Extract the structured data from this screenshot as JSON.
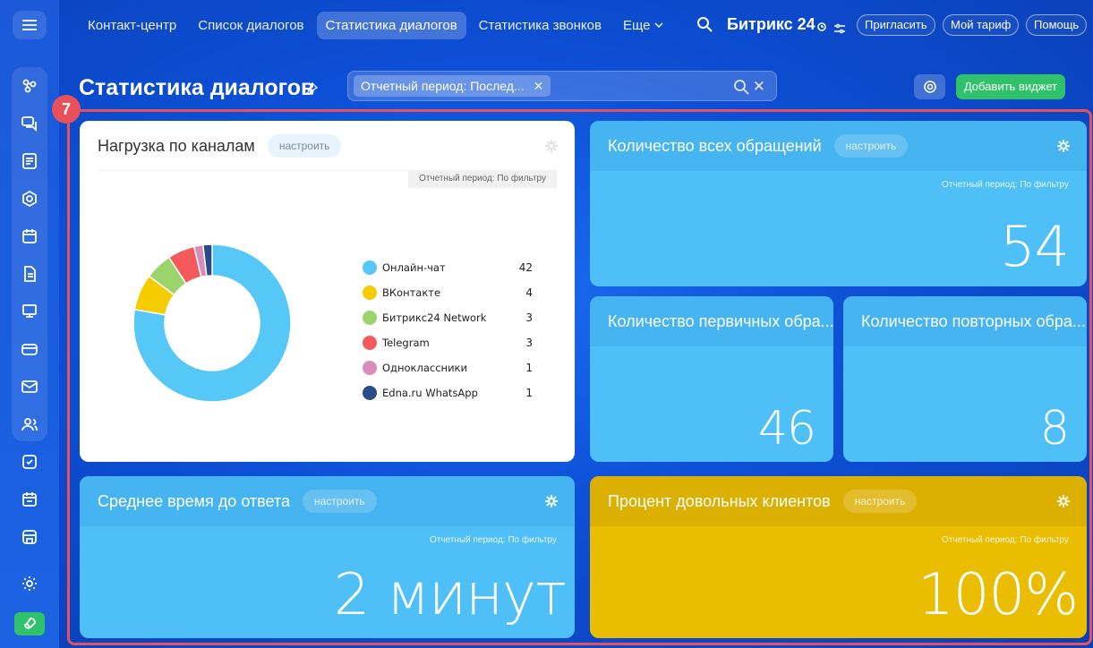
{
  "nav": {
    "items": [
      "Контакт-центр",
      "Список диалогов",
      "Статистика диалогов",
      "Статистика звонков"
    ],
    "more_label": "Еще"
  },
  "brand": {
    "name": "Битрикс 24"
  },
  "header_buttons": {
    "invite": "Пригласить",
    "tariff": "Мой тариф",
    "help": "Помощь"
  },
  "page": {
    "title": "Статистика диалогов"
  },
  "filter": {
    "chip": "Отчетный период: Послед..."
  },
  "actions": {
    "add_widget": "Добавить виджет"
  },
  "highlight": {
    "number": "7"
  },
  "widgets": {
    "channels": {
      "title": "Нагрузка по каналам",
      "configure": "настроить",
      "period": "Отчетный период: По фильтру",
      "items": [
        {
          "name": "Онлайн-чат",
          "count": 42,
          "color": "#55c8f8"
        },
        {
          "name": "ВКонтакте",
          "count": 4,
          "color": "#f5cc00"
        },
        {
          "name": "Битрикс24 Network",
          "count": 3,
          "color": "#9bd46a"
        },
        {
          "name": "Telegram",
          "count": 3,
          "color": "#f45a5c"
        },
        {
          "name": "Одноклассники",
          "count": 1,
          "color": "#d98dbb"
        },
        {
          "name": "Edna.ru WhatsApp",
          "count": 1,
          "color": "#2b4a8a"
        }
      ]
    },
    "all_requests": {
      "title": "Количество всех обращений",
      "configure": "настроить",
      "period": "Отчетный период: По фильтру",
      "value": "54"
    },
    "first_requests": {
      "title": "Количество первичных обра...",
      "value": "46"
    },
    "repeat_requests": {
      "title": "Количество повторных обра...",
      "value": "8"
    },
    "response_time": {
      "title": "Среднее время до ответа",
      "configure": "настроить",
      "period": "Отчетный период: По фильтру",
      "value": "2 минут"
    },
    "satisfaction": {
      "title": "Процент довольных клиентов",
      "configure": "настроить",
      "period": "Отчетный период: По фильтру",
      "value": "100%"
    }
  },
  "colors": {
    "accent_green": "#2fc26b",
    "highlight_red": "#e8505b",
    "widget_blue": "#4fc0f7",
    "widget_yellow": "#ebbd00"
  },
  "icons": {
    "sidebar": [
      "menu-icon",
      "flow-icon",
      "chat-icon",
      "feed-icon",
      "shield-icon",
      "calendar-icon",
      "document-icon",
      "presentation-icon",
      "card-icon",
      "mail-icon",
      "contacts-icon",
      "task-check-icon",
      "schedule-icon",
      "store-icon",
      "settings-icon",
      "rocket-icon"
    ]
  }
}
